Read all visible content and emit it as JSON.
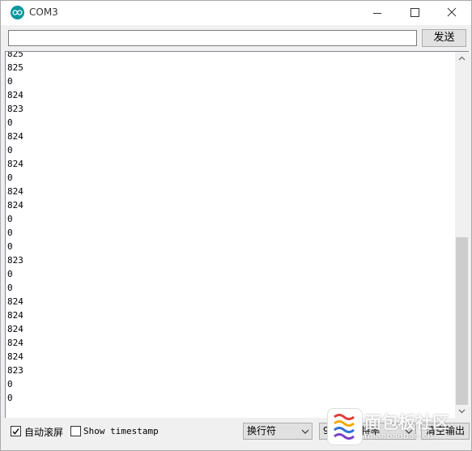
{
  "window": {
    "title": "COM3",
    "accent_color": "#00979d"
  },
  "send_bar": {
    "input_value": "",
    "send_label": "发送"
  },
  "output": {
    "lines": [
      "825",
      "825",
      "0",
      "824",
      "823",
      "0",
      "824",
      "0",
      "824",
      "0",
      "824",
      "824",
      "0",
      "0",
      "0",
      "823",
      "0",
      "0",
      "824",
      "824",
      "824",
      "824",
      "824",
      "823",
      "0",
      "0"
    ]
  },
  "bottom_bar": {
    "autoscroll_checked": true,
    "autoscroll_label": "自动滚屏",
    "timestamp_checked": false,
    "timestamp_label": "Show timestamp",
    "line_ending_value": "换行符",
    "baud_value": "9600 波特率",
    "clear_label": "清空输出"
  },
  "watermark": {
    "text": "面包板社区",
    "subtext": "mianbaoban.cn"
  }
}
